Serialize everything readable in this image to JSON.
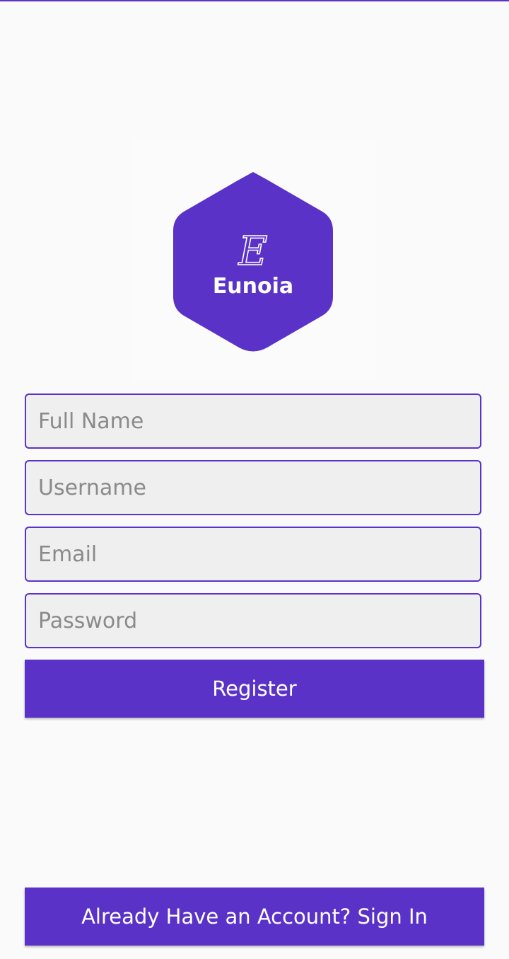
{
  "brand": {
    "logo_text": "Eunoia",
    "logo_initial": "E",
    "accent_color": "#5b32c8"
  },
  "form": {
    "full_name_placeholder": "Full Name",
    "username_placeholder": "Username",
    "email_placeholder": "Email",
    "password_placeholder": "Password"
  },
  "actions": {
    "register_label": "Register",
    "sign_in_label": "Already Have an Account? Sign In"
  }
}
